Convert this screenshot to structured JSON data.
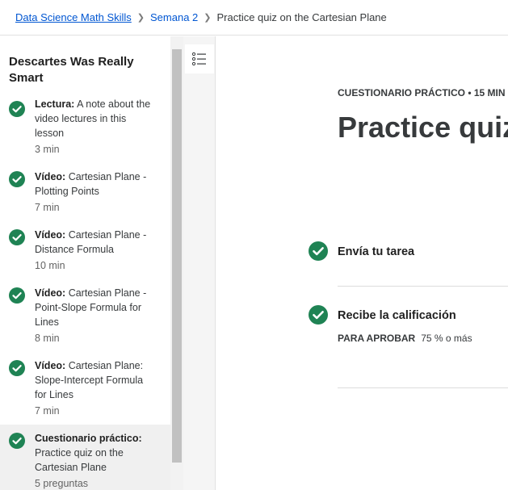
{
  "breadcrumb": {
    "course": "Data Science Math Skills",
    "week": "Semana 2",
    "current": "Practice quiz on the Cartesian Plane"
  },
  "sidebar": {
    "title": "Descartes Was Really Smart",
    "items": [
      {
        "type": "Lectura:",
        "title": "A note about the video lectures in this lesson",
        "meta": "3 min"
      },
      {
        "type": "Vídeo:",
        "title": "Cartesian Plane - Plotting Points",
        "meta": "7 min"
      },
      {
        "type": "Vídeo:",
        "title": "Cartesian Plane - Distance Formula",
        "meta": "10 min"
      },
      {
        "type": "Vídeo:",
        "title": "Cartesian Plane - Point-Slope Formula for Lines",
        "meta": "8 min"
      },
      {
        "type": "Vídeo:",
        "title": "Cartesian Plane: Slope-Intercept Formula for Lines",
        "meta": "7 min"
      },
      {
        "type": "Cuestionario práctico:",
        "title": "Practice quiz on the Cartesian Plane",
        "meta": "5 preguntas"
      }
    ]
  },
  "main": {
    "kicker": "CUESTIONARIO PRÁCTICO • 15 MIN",
    "title": "Practice quiz on the Cartesian Plane",
    "steps": [
      {
        "label": "Envía tu tarea"
      },
      {
        "label": "Recibe la calificación"
      }
    ],
    "pass_label": "PARA APROBAR",
    "pass_value": "75 % o más"
  },
  "colors": {
    "accent": "#0056d2",
    "success": "#1f8354",
    "text": "#373a3c"
  },
  "icons": {
    "check": "check-circle-icon",
    "toc": "list-icon",
    "chevron": "chevron-right-icon"
  }
}
